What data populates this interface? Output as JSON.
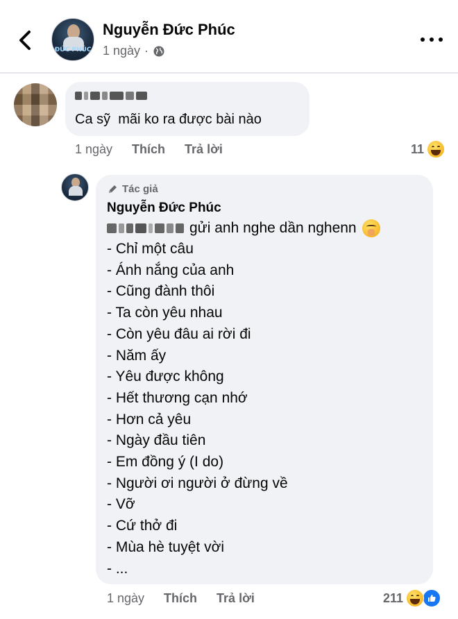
{
  "header": {
    "author": "Nguyễn Đức Phúc",
    "time": "1 ngày",
    "separator": "·",
    "avatar_text": "ĐỨC PHÚC"
  },
  "comment": {
    "text": "Ca sỹ  mãi ko ra được bài nào",
    "time": "1 ngày",
    "like_label": "Thích",
    "reply_label": "Trả lời",
    "reaction_count": "11"
  },
  "reply": {
    "badge": "Tác giả",
    "author": "Nguyễn Đức Phúc",
    "intro": "gửi anh nghe dần nghenn",
    "songs": [
      "- Chỉ một câu",
      "- Ánh nắng của anh",
      "- Cũng đành thôi",
      "- Ta còn yêu nhau",
      "- Còn yêu đâu ai rời đi",
      "- Năm ấy",
      "- Yêu được không",
      "- Hết thương cạn nhớ",
      "- Hơn cả yêu",
      "- Ngày đầu tiên",
      "- Em đồng ý (I do)",
      "- Người ơi người ở đừng về",
      "- Vỡ",
      "- Cứ thở đi",
      "- Mùa hè tuyệt vời",
      "- ..."
    ],
    "time": "1 ngày",
    "like_label": "Thích",
    "reply_label": "Trả lời",
    "reaction_count": "211"
  },
  "icons": {
    "back": "chevron-left-icon",
    "privacy": "globe-icon",
    "more": "more-dots-icon",
    "author_badge": "pencil-icon",
    "reaction_haha": "laugh-emoji-icon",
    "reaction_like": "like-thumb-icon",
    "intro_emoji": "shush-emoji-icon"
  },
  "colors": {
    "bubble": "#f0f2f5",
    "meta": "#65676b",
    "like_blue": "#1877f2",
    "text": "#050505"
  }
}
